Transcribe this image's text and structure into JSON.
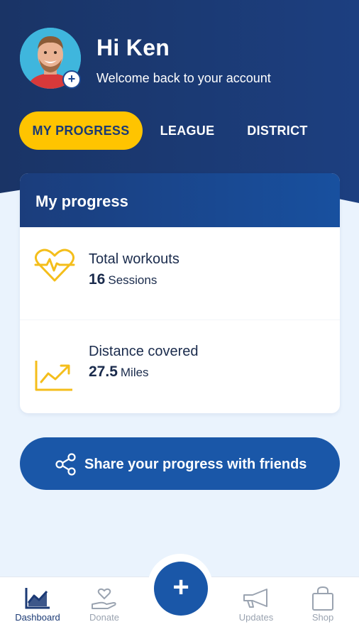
{
  "header": {
    "greeting": "Hi Ken",
    "subtitle": "Welcome back to your account",
    "avatar_icon": "user-photo",
    "avatar_add_label": "+"
  },
  "tabs": [
    {
      "label": "MY PROGRESS",
      "active": true
    },
    {
      "label": "LEAGUE",
      "active": false
    },
    {
      "label": "DISTRICT",
      "active": false
    }
  ],
  "progress_card": {
    "title": "My progress",
    "stats": [
      {
        "icon": "heart-pulse-icon",
        "label": "Total workouts",
        "value": "16",
        "unit": "Sessions"
      },
      {
        "icon": "trend-chart-icon",
        "label": "Distance covered",
        "value": "27.5",
        "unit": "Miles"
      }
    ]
  },
  "share_button": {
    "label": "Share your progress with friends",
    "icon": "share-icon"
  },
  "fab": {
    "label": "+"
  },
  "bottom_nav": [
    {
      "label": "Dashboard",
      "icon": "chart-icon",
      "active": true
    },
    {
      "label": "Donate",
      "icon": "heart-hand-icon",
      "active": false
    },
    {
      "label": "Updates",
      "icon": "megaphone-icon",
      "active": false
    },
    {
      "label": "Shop",
      "icon": "shopping-bag-icon",
      "active": false
    }
  ],
  "colors": {
    "primary": "#1b3a75",
    "accent": "#ffc400",
    "button_blue": "#1a57a8",
    "background": "#eaf3fd"
  }
}
